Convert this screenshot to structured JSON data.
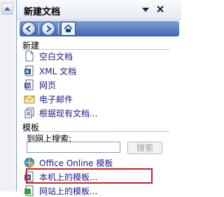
{
  "pane": {
    "title": "新建文档"
  },
  "new_section": {
    "heading": "新建",
    "items": [
      {
        "label": "空白文档",
        "icon": "blank-document-icon"
      },
      {
        "label": "XML 文档",
        "icon": "xml-document-icon"
      },
      {
        "label": "网页",
        "icon": "web-page-icon"
      },
      {
        "label": "电子邮件",
        "icon": "email-icon"
      },
      {
        "label": "根据现有文档...",
        "icon": "existing-document-icon"
      }
    ]
  },
  "templates_section": {
    "heading": "模板",
    "search_label": "到网上搜索:",
    "search_value": "",
    "search_button": "搜索",
    "items": [
      {
        "label": "Office Online 模板",
        "icon": "office-online-icon"
      },
      {
        "label": "本机上的模板...",
        "icon": "local-templates-icon"
      },
      {
        "label": "网站上的模板...",
        "icon": "website-templates-icon"
      }
    ]
  },
  "colors": {
    "highlight": "#cc1f1f",
    "link": "#1a1a8c",
    "toolbar": "#3f66b3"
  }
}
